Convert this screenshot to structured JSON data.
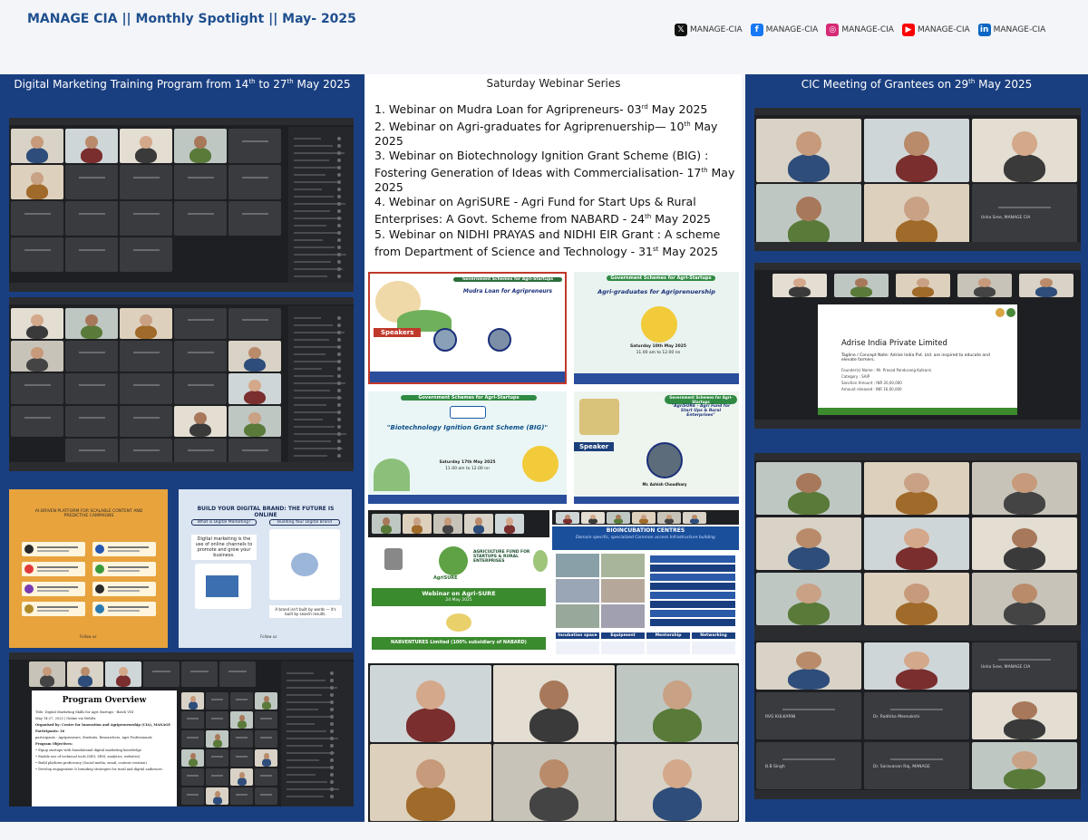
{
  "header": {
    "title": "MANAGE CIA || Monthly Spotlight || May- 2025"
  },
  "socials": [
    {
      "icon": "x-icon",
      "glyph": "𝕏",
      "color": "#111111",
      "label": "MANAGE-CIA"
    },
    {
      "icon": "facebook-icon",
      "glyph": "f",
      "color": "#1877f2",
      "label": "MANAGE-CIA"
    },
    {
      "icon": "instagram-icon",
      "glyph": "◎",
      "color": "#d62976",
      "label": "MANAGE-CIA"
    },
    {
      "icon": "youtube-icon",
      "glyph": "▶",
      "color": "#ff0000",
      "label": "MANAGE-CIA"
    },
    {
      "icon": "linkedin-icon",
      "glyph": "in",
      "color": "#0a66c2",
      "label": "MANAGE-CIA"
    }
  ],
  "left_column": {
    "heading": "Digital Marketing Training Program from  14",
    "heading_sup": "th",
    "heading_mid": " to 27",
    "heading_sup2": "th",
    "heading_end": " May 2025"
  },
  "middle_column": {
    "heading": "Saturday Webinar Series",
    "webinars": [
      {
        "pre": "1. Webinar on Mudra Loan for Agripreneurs- 03",
        "sup": "rd",
        "post": " May 2025"
      },
      {
        "pre": "2. Webinar on Agri-graduates for Agriprenuership— 10",
        "sup": "th",
        "post": " May 2025"
      },
      {
        "pre": "3. Webinar on Biotechnology Ignition Grant Scheme (BIG) : Fostering Generation of Ideas with Commercialisation- 17",
        "sup": "th",
        "post": " May 2025"
      },
      {
        "pre": "4. Webinar on AgriSURE - Agri Fund for Start Ups & Rural Enterprises: A Govt. Scheme from NABARD - 24",
        "sup": "th",
        "post": " May 2025"
      },
      {
        "pre": "5. Webinar on NIDHI PRAYAS and NIDHI EIR Grant : A scheme from Department of Science and Technology - 31",
        "sup": "st",
        "post": " May 2025"
      }
    ],
    "posters": {
      "mudra_title": "Mudra Loan for Agripreneurs",
      "mudra_banner": "Government Schemes for Agri-Startups",
      "speakers": "Speakers",
      "agrigrad_banner": "Government Schemes for Agri-Startups",
      "agrigrad_title": "Agri-graduates for Agriprenuership",
      "agrigrad_date": "Saturday 10th May 2025",
      "agrigrad_time": "11.00 am to 12.00 nn",
      "big_banner": "Government Schemes for Agri-Startups",
      "big_title": "\"Biotechnology Ignition Grant Scheme (BIG)\"",
      "big_date": "Saturday 17th May 2025",
      "big_time": "11.00 am to 12.00 nn",
      "agrisure_banner": "Government Schemes for Agri-Startups",
      "agrisure_title": "\"AgriSURE - Agri Fund for Start Ups & Rural Enterprises\"",
      "speaker": "Speaker",
      "speaker_name": "Mr. Ashish Choudhary",
      "webinar_agrisure": "Webinar on Agri-SURE",
      "webinar_agrisure_date": "24 May 2025",
      "agrisure_logo": "AgriSURE",
      "fund_title": "AGRICULTURE FUND FOR STARTUPS & RURAL ENTERPRISES",
      "nabventures": "NABVENTURES Limited (100% subsidiary of NABARD)",
      "bioinc_title": "BIOINCUBATION CENTRES",
      "bioinc_sub": "Domain specific, specialized Common access Infrastructure building",
      "bioinc_tabs": [
        "Incubation space",
        "Equipment",
        "Mentorship",
        "Networking"
      ]
    }
  },
  "right_column": {
    "heading": "CIC Meeting of Grantees on  29",
    "heading_sup": "th",
    "heading_end": " May 2025",
    "company_name": "Adrise India Private Limited",
    "company_tagline": "Tagline / Concept Note:  Adrise India Pvt. Ltd. are inspired to educate and elevate farmers.",
    "company_details": [
      "Founder(s) Name : Mr. Prasad Pandurang Kulkarni",
      "Category : SAIP",
      "Sanction Amount : INR 20,00,000",
      "Amount released : INR 16,00,000"
    ],
    "tile_names": [
      "Usha Sree, MANAGE CIA",
      "Usha Sree, MANAGE CIA",
      "RVG KULKARNI",
      "Dr. Radhika Meenakshi",
      "B.B Singh",
      "Dr. Saravanan Raj, MANAGE"
    ]
  },
  "left_posters": {
    "ai_title": "AI-DRIVEN PLATFORM FOR SCALABLE CONTENT AND PREDICTIVE CAMPAIGNS",
    "brand_title": "BUILD YOUR DIGITAL BRAND: THE FUTURE IS ONLINE",
    "what_is": "What is Digital Marketing?",
    "building": "Building Your Digital Brand",
    "dm_desc": "Digital marketing is the use of online channels to promote and grow your business.",
    "brand_quote": "A brand isn't built by words — it's built by search results.",
    "follow": "Follow us",
    "program_overview": "Program Overview",
    "program_lines": [
      "Title: Digital Marketing Skills for Agri Startups - Batch VIII",
      "May 14-27, 2025 | Online via WebEx",
      "Organised by: Centre for Innovation and Agripreneurship (CIA), MANAGE",
      "Participants: 26",
      "participants - Agripreneurs, Students, Researchers, Agri Professionals",
      "Program Objectives:",
      "• Equip startups with foundational digital marketing knowledge",
      "• Enable use of technical tools (SEO, SEM, analytics, websites)",
      "• Build platform proficiency (Social media, email, content creation)",
      "• Develop engagement & branding strategies for rural and digital audiences"
    ]
  }
}
